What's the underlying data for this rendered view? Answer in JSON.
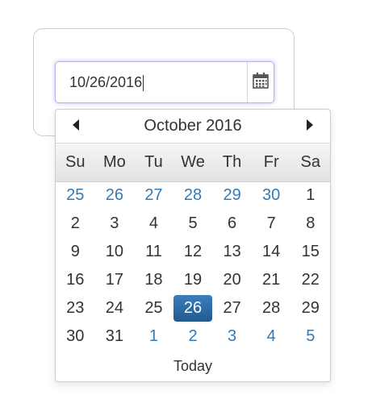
{
  "input": {
    "value": "10/26/2016"
  },
  "icons": {
    "calendar": "calendar-icon",
    "prev": "arrow-left-icon",
    "next": "arrow-right-icon"
  },
  "calendar": {
    "month_title": "October 2016",
    "weekdays": [
      "Su",
      "Mo",
      "Tu",
      "We",
      "Th",
      "Fr",
      "Sa"
    ],
    "weeks": [
      [
        {
          "d": "25",
          "other": true
        },
        {
          "d": "26",
          "other": true
        },
        {
          "d": "27",
          "other": true
        },
        {
          "d": "28",
          "other": true
        },
        {
          "d": "29",
          "other": true
        },
        {
          "d": "30",
          "other": true
        },
        {
          "d": "1"
        }
      ],
      [
        {
          "d": "2"
        },
        {
          "d": "3"
        },
        {
          "d": "4"
        },
        {
          "d": "5"
        },
        {
          "d": "6"
        },
        {
          "d": "7"
        },
        {
          "d": "8"
        }
      ],
      [
        {
          "d": "9"
        },
        {
          "d": "10"
        },
        {
          "d": "11"
        },
        {
          "d": "12"
        },
        {
          "d": "13"
        },
        {
          "d": "14"
        },
        {
          "d": "15"
        }
      ],
      [
        {
          "d": "16"
        },
        {
          "d": "17"
        },
        {
          "d": "18"
        },
        {
          "d": "19"
        },
        {
          "d": "20"
        },
        {
          "d": "21"
        },
        {
          "d": "22"
        }
      ],
      [
        {
          "d": "23"
        },
        {
          "d": "24"
        },
        {
          "d": "25"
        },
        {
          "d": "26",
          "active": true
        },
        {
          "d": "27"
        },
        {
          "d": "28"
        },
        {
          "d": "29"
        }
      ],
      [
        {
          "d": "30"
        },
        {
          "d": "31"
        },
        {
          "d": "1",
          "other": true
        },
        {
          "d": "2",
          "other": true
        },
        {
          "d": "3",
          "other": true
        },
        {
          "d": "4",
          "other": true
        },
        {
          "d": "5",
          "other": true
        }
      ]
    ],
    "today_label": "Today"
  },
  "colors": {
    "accent": "#337ab7",
    "active_bg": "#2b6aa3",
    "text": "#333333",
    "focus": "#b9b3ec"
  }
}
